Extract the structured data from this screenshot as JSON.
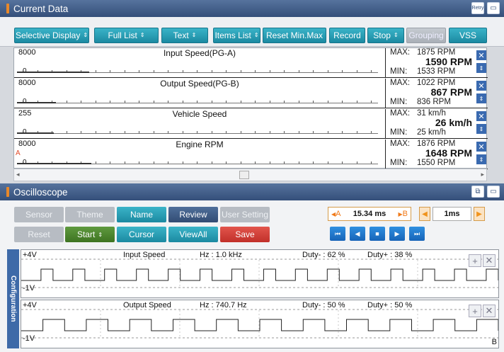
{
  "current_data": {
    "title": "Current Data",
    "icons": [
      "retry-icon",
      "window-icon"
    ],
    "retry_label": "Retry",
    "toolbar": [
      {
        "label": "Selective Display",
        "dropdown": true
      },
      {
        "label": "Full List",
        "dropdown": true
      },
      {
        "label": "Text",
        "dropdown": true
      },
      {
        "label": "Items List",
        "dropdown": true
      },
      {
        "label": "Reset Min.Max",
        "dropdown": false
      },
      {
        "label": "Record",
        "dropdown": false
      },
      {
        "label": "Stop",
        "dropdown": true
      },
      {
        "label": "Grouping",
        "dropdown": false,
        "disabled": true
      },
      {
        "label": "VSS",
        "dropdown": false
      }
    ],
    "rows": [
      {
        "name": "Input Speed(PG-A)",
        "scale_max": "8000",
        "scale_min": "0",
        "max_label": "MAX:",
        "max": "1875 RPM",
        "value": "1590 RPM",
        "min_label": "MIN:",
        "min": "1533 RPM",
        "level": 0.199
      },
      {
        "name": "Output Speed(PG-B)",
        "scale_max": "8000",
        "scale_min": "0",
        "max_label": "MAX:",
        "max": "1022 RPM",
        "value": "867 RPM",
        "min_label": "MIN:",
        "min": "836 RPM",
        "level": 0.108
      },
      {
        "name": "Vehicle Speed",
        "scale_max": "255",
        "scale_min": "0",
        "max_label": "MAX:",
        "max": "31 km/h",
        "value": "26 km/h",
        "min_label": "MIN:",
        "min": "25 km/h",
        "level": 0.102
      },
      {
        "name": "Engine RPM",
        "scale_max": "8000",
        "scale_min": "0",
        "max_label": "MAX:",
        "max": "1876 RPM",
        "value": "1648 RPM",
        "min_label": "MIN:",
        "min": "1550 RPM",
        "level": 0.206,
        "alarm": "A"
      }
    ]
  },
  "oscilloscope": {
    "title": "Oscilloscope",
    "buttons_row1": [
      {
        "label": "Sensor",
        "style": "dis"
      },
      {
        "label": "Theme",
        "style": "dis"
      },
      {
        "label": "Name",
        "style": "teal"
      },
      {
        "label": "Review",
        "style": "navy"
      },
      {
        "label": "User Setting",
        "style": "dis"
      }
    ],
    "buttons_row2": [
      {
        "label": "Reset",
        "style": "dis"
      },
      {
        "label": "Start",
        "style": "green"
      },
      {
        "label": "Cursor",
        "style": "teal"
      },
      {
        "label": "ViewAll",
        "style": "teal"
      },
      {
        "label": "Save",
        "style": "red"
      }
    ],
    "cursor_a": "A",
    "cursor_time": "15.34 ms",
    "cursor_b": "B",
    "time_div": "1ms",
    "playback_icons": [
      "skip-start-icon",
      "prev-icon",
      "stop-icon",
      "play-icon",
      "skip-end-icon"
    ],
    "config_label": "Configuration",
    "channels": [
      {
        "name": "Input Speed",
        "top": "+4V",
        "bottom": "-1V",
        "hz": "Hz : 1.0 kHz",
        "duty_neg": "Duty- : 62 %",
        "duty_pos": "Duty+ : 38 %",
        "pulses": 15
      },
      {
        "name": "Output Speed",
        "top": "+4V",
        "bottom": "-1V",
        "hz": "Hz : 740.7 Hz",
        "duty_neg": "Duty- : 50 %",
        "duty_pos": "Duty+ : 50 %",
        "pulses": 11,
        "marker": "B"
      }
    ]
  },
  "colors": {
    "title_bar": "#3d5882",
    "accent": "#1f8ea6",
    "cursor": "#f07a1a"
  }
}
